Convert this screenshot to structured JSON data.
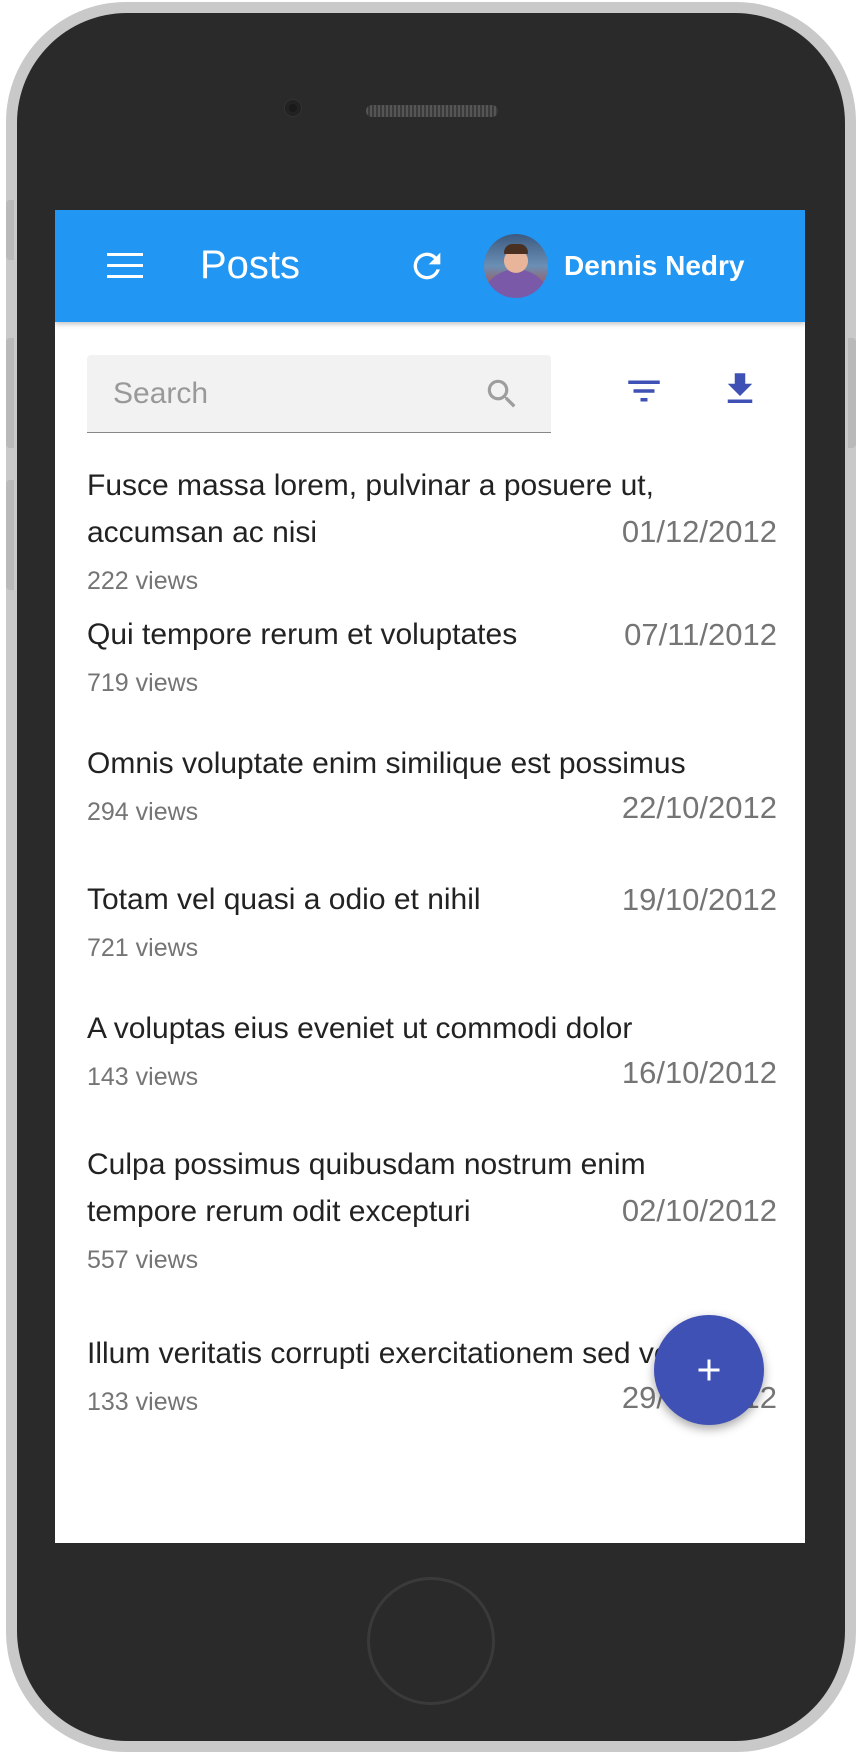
{
  "appbar": {
    "title": "Posts",
    "user_name": "Dennis Nedry"
  },
  "search": {
    "placeholder": "Search"
  },
  "posts": [
    {
      "title": "Fusce massa lorem, pulvinar a posuere ut, accumsan ac nisi",
      "views": "222 views",
      "date": "01/12/2012"
    },
    {
      "title": "Qui tempore rerum et voluptates",
      "views": "719 views",
      "date": "07/11/2012"
    },
    {
      "title": "Omnis voluptate enim similique est possimus",
      "views": "294 views",
      "date": "22/10/2012"
    },
    {
      "title": "Totam vel quasi a odio et nihil",
      "views": "721 views",
      "date": "19/10/2012"
    },
    {
      "title": "A voluptas eius eveniet ut commodi dolor",
      "views": "143 views",
      "date": "16/10/2012"
    },
    {
      "title": "Culpa possimus quibusdam nostrum enim tempore rerum odit excepturi",
      "views": "557 views",
      "date": "02/10/2012"
    },
    {
      "title": "Illum veritatis corrupti exercitationem sed velit",
      "views": "133 views",
      "date": "29/09/2012"
    }
  ],
  "colors": {
    "appbar": "#2196f3",
    "accent": "#3f51b5",
    "secondary_text": "#757575"
  },
  "icons": {
    "menu": "menu-icon",
    "refresh": "refresh-icon",
    "search": "search-icon",
    "filter": "filter-icon",
    "download": "download-icon",
    "fab": "plus-icon"
  }
}
